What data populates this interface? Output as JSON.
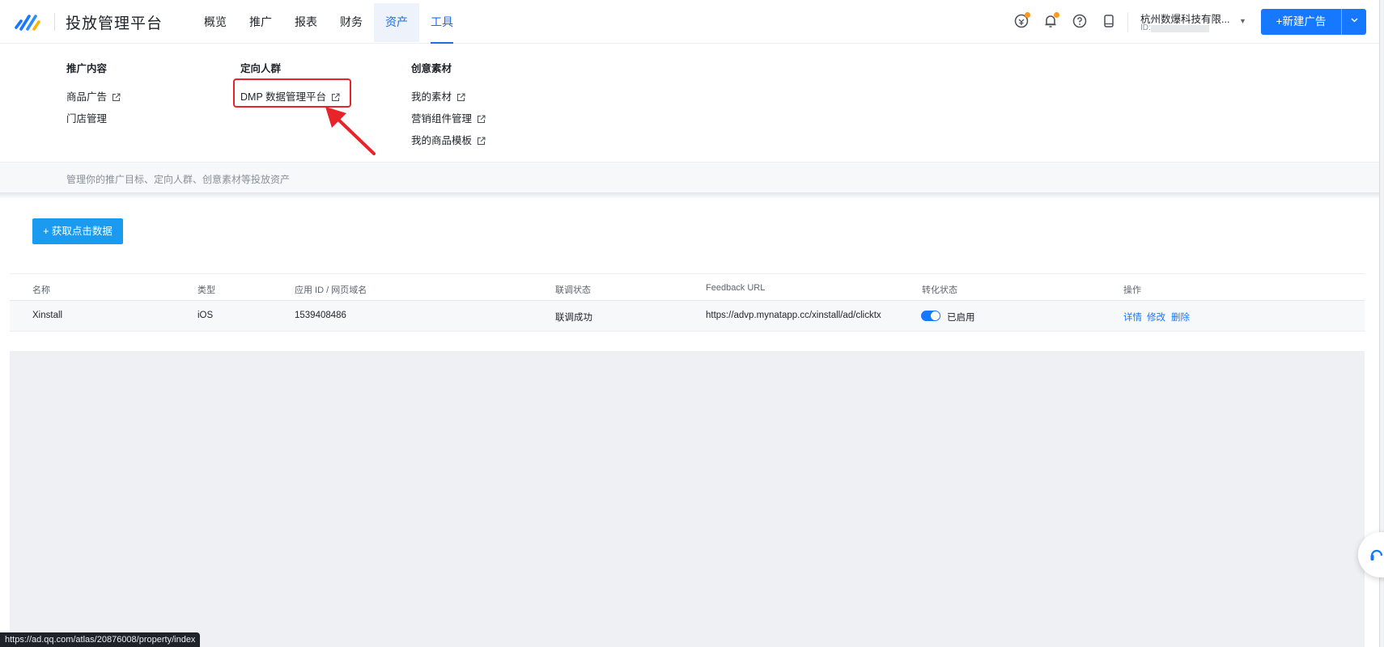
{
  "brand": {
    "name": "投放管理平台"
  },
  "nav": {
    "tabs": [
      {
        "label": "概览"
      },
      {
        "label": "推广"
      },
      {
        "label": "报表"
      },
      {
        "label": "财务"
      },
      {
        "label": "资产"
      },
      {
        "label": "工具"
      }
    ]
  },
  "header": {
    "icons": [
      "coin-alert-icon",
      "bell-icon",
      "help-icon",
      "device-icon"
    ],
    "account_name": "杭州数爆科技有限...",
    "account_id_label": "ID:",
    "new_ad_label": "+新建广告"
  },
  "mega_menu": {
    "columns": [
      {
        "title": "推广内容",
        "items": [
          "商品广告",
          "门店管理"
        ]
      },
      {
        "title": "定向人群",
        "items": [
          "DMP 数据管理平台"
        ]
      },
      {
        "title": "创意素材",
        "items": [
          "我的素材",
          "营销组件管理",
          "我的商品模板"
        ]
      }
    ],
    "footer_text": "管理你的推广目标、定向人群、创意素材等投放资产"
  },
  "toolbar": {
    "fetch_label": "+ 获取点击数据"
  },
  "table": {
    "columns": [
      "名称",
      "类型",
      "应用 ID / 网页域名",
      "联调状态",
      "Feedback URL",
      "转化状态",
      "操作"
    ],
    "rows": [
      {
        "name": "Xinstall",
        "type": "iOS",
        "app_id": "1539408486",
        "debug_status": "联调成功",
        "feedback_url": "https://advp.mynatapp.cc/xinstall/ad/clicktx",
        "conversion_status": "已启用",
        "actions": [
          "详情",
          "修改",
          "删除"
        ]
      }
    ]
  },
  "status_bar": {
    "url": "https://ad.qq.com/atlas/20876008/property/index"
  },
  "colors": {
    "accent": "#1677ff",
    "highlight": "#e8242b",
    "fetch_button": "#1a9bf0"
  }
}
